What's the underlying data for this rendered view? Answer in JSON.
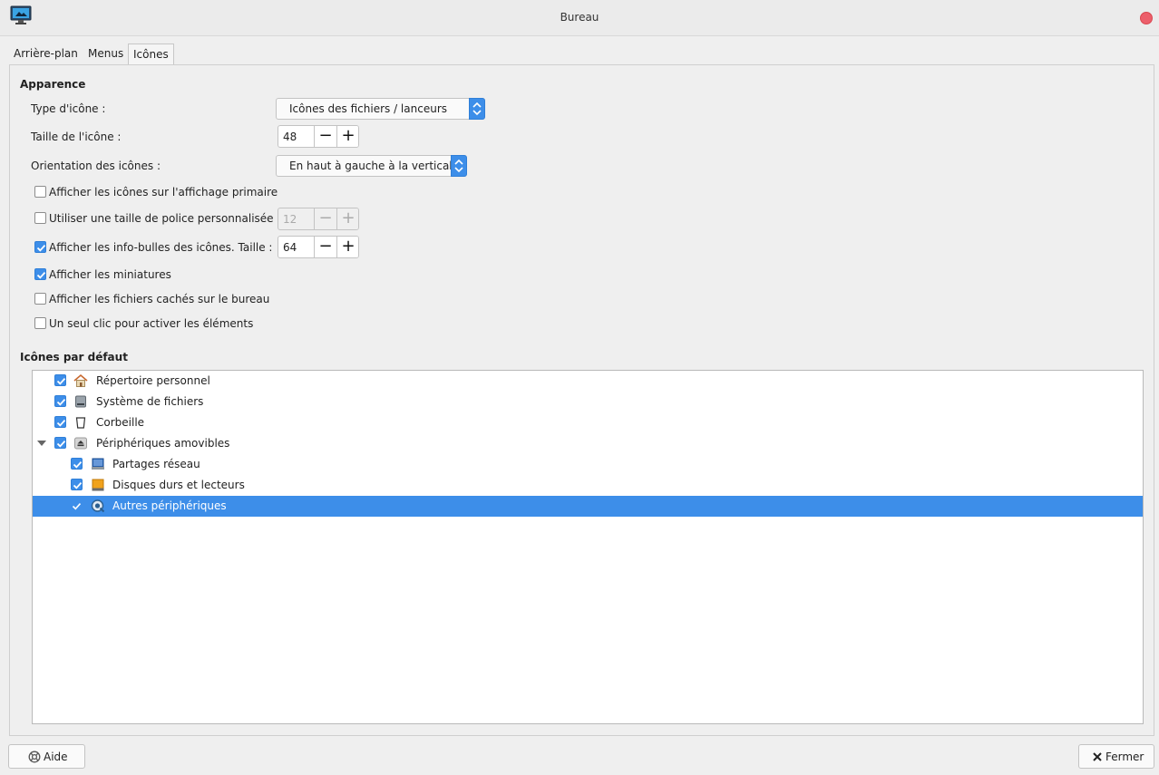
{
  "window": {
    "title": "Bureau"
  },
  "tabs": [
    {
      "label": "Arrière-plan"
    },
    {
      "label": "Menus"
    },
    {
      "label": "Icônes"
    }
  ],
  "appearance": {
    "title": "Apparence",
    "icon_type_label": "Type d'icône :",
    "icon_type_value": "Icônes des fichiers / lanceurs",
    "icon_size_label": "Taille de l'icône :",
    "icon_size_value": "48",
    "orientation_label": "Orientation des icônes :",
    "orientation_value": "En haut à gauche à la verticale",
    "primary_display_label": "Afficher les icônes sur l'affichage primaire",
    "custom_font_label": "Utiliser une taille de police personnalisée :",
    "custom_font_value": "12",
    "tooltips_label": "Afficher les info-bulles des icônes. Taille :",
    "tooltips_value": "64",
    "thumbnails_label": "Afficher les miniatures",
    "hidden_files_label": "Afficher les fichiers cachés sur le bureau",
    "single_click_label": "Un seul clic pour activer les éléments"
  },
  "defaults": {
    "title": "Icônes par défaut",
    "items": [
      {
        "label": "Répertoire personnel"
      },
      {
        "label": "Système de fichiers"
      },
      {
        "label": "Corbeille"
      },
      {
        "label": "Périphériques amovibles"
      },
      {
        "label": "Partages réseau"
      },
      {
        "label": "Disques durs et lecteurs"
      },
      {
        "label": "Autres périphériques"
      }
    ]
  },
  "footer": {
    "help_label": "Aide",
    "close_label": "Fermer"
  },
  "colors": {
    "accent": "#3d8ee9",
    "close": "#ec5f6b"
  }
}
